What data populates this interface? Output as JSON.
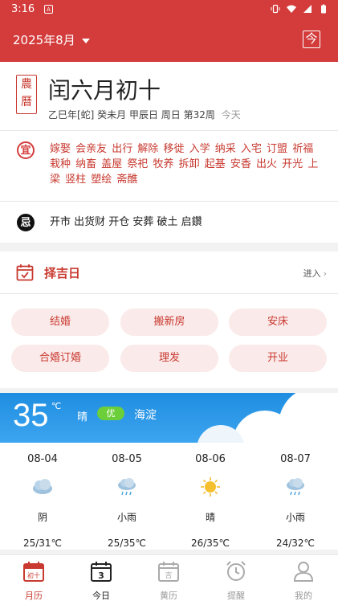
{
  "status": {
    "time": "3:16",
    "notif": "A"
  },
  "header": {
    "month": "2025年8月",
    "today_btn": "今"
  },
  "lunar": {
    "seal_top": "農",
    "seal_bottom": "曆",
    "date": "闰六月初十",
    "ganzhi": "乙巳年[蛇] 癸未月 甲辰日  周日 第32周",
    "today_tag": "今天",
    "yi_label": "宜",
    "yi": "嫁娶 会亲友 出行 解除 移徙 入学 纳采 入宅 订盟 祈福 栽种 纳畜 盖屋 祭祀 牧养 拆卸 起基 安香 出火 开光 上梁 竖柱 塑绘 斋醮",
    "ji_label": "忌",
    "ji": "开市 出货财 开仓 安葬 破土 启鑽"
  },
  "zeji": {
    "title": "择吉日",
    "enter": "进入",
    "items": [
      "结婚",
      "搬新房",
      "安床",
      "合婚订婚",
      "理发",
      "开业"
    ]
  },
  "weather": {
    "temp": "35",
    "unit": "℃",
    "condition": "晴",
    "aqi": "优",
    "district": "海淀",
    "forecast": [
      {
        "date": "08-04",
        "icon": "cloudy-icon",
        "cond": "阴",
        "range": "25/31℃"
      },
      {
        "date": "08-05",
        "icon": "light-rain-icon",
        "cond": "小雨",
        "range": "25/35℃"
      },
      {
        "date": "08-06",
        "icon": "sunny-icon",
        "cond": "晴",
        "range": "26/35℃"
      },
      {
        "date": "08-07",
        "icon": "light-rain-icon",
        "cond": "小雨",
        "range": "24/32℃"
      }
    ]
  },
  "nav": [
    {
      "label": "月历",
      "icon": "month-calendar-icon",
      "badge": "初十"
    },
    {
      "label": "今日",
      "icon": "today-calendar-icon",
      "badge": "3"
    },
    {
      "label": "黄历",
      "icon": "almanac-icon",
      "badge": "吉"
    },
    {
      "label": "提醒",
      "icon": "alarm-clock-icon"
    },
    {
      "label": "我的",
      "icon": "user-icon"
    }
  ],
  "colors": {
    "primary": "#d43c3c",
    "sky": "#1f8de0",
    "aqi_good": "#6ccf3a"
  }
}
